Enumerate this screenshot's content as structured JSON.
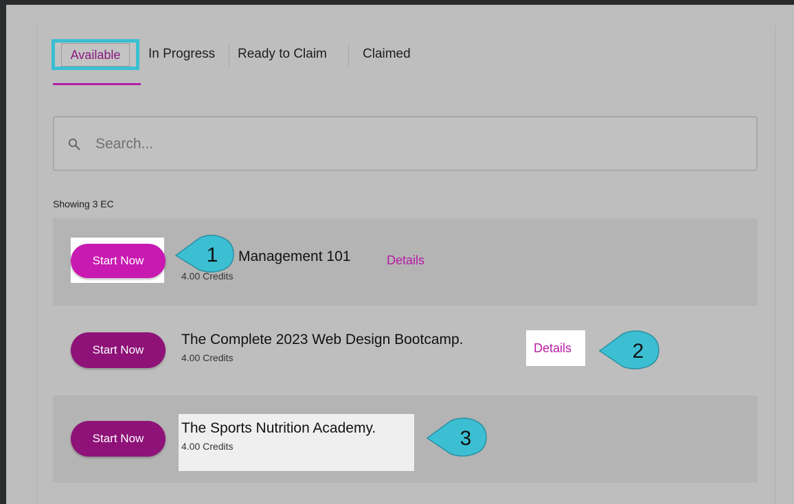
{
  "tabs": [
    {
      "label": "Available"
    },
    {
      "label": "In Progress"
    },
    {
      "label": "Ready to Claim"
    },
    {
      "label": "Claimed"
    }
  ],
  "search": {
    "placeholder": "Search..."
  },
  "showing_text": "Showing 3 EC",
  "courses": [
    {
      "button": "Start Now",
      "title": "Management 101",
      "credits": "4.00 Credits",
      "details": "Details",
      "callout": "1"
    },
    {
      "button": "Start Now",
      "title": "The Complete 2023 Web Design Bootcamp.",
      "credits": "4.00 Credits",
      "details": "Details",
      "callout": "2"
    },
    {
      "button": "Start Now",
      "title": "The Sports Nutrition Academy.",
      "credits": "4.00 Credits",
      "callout": "3"
    }
  ],
  "colors": {
    "accent": "#b81aa6",
    "button_highlighted": "#c81ab1",
    "button": "#8e1278",
    "callout": "#3cbfd3",
    "tab_highlight_border": "#3cbfd3"
  },
  "icons": {
    "search": "search-icon"
  }
}
